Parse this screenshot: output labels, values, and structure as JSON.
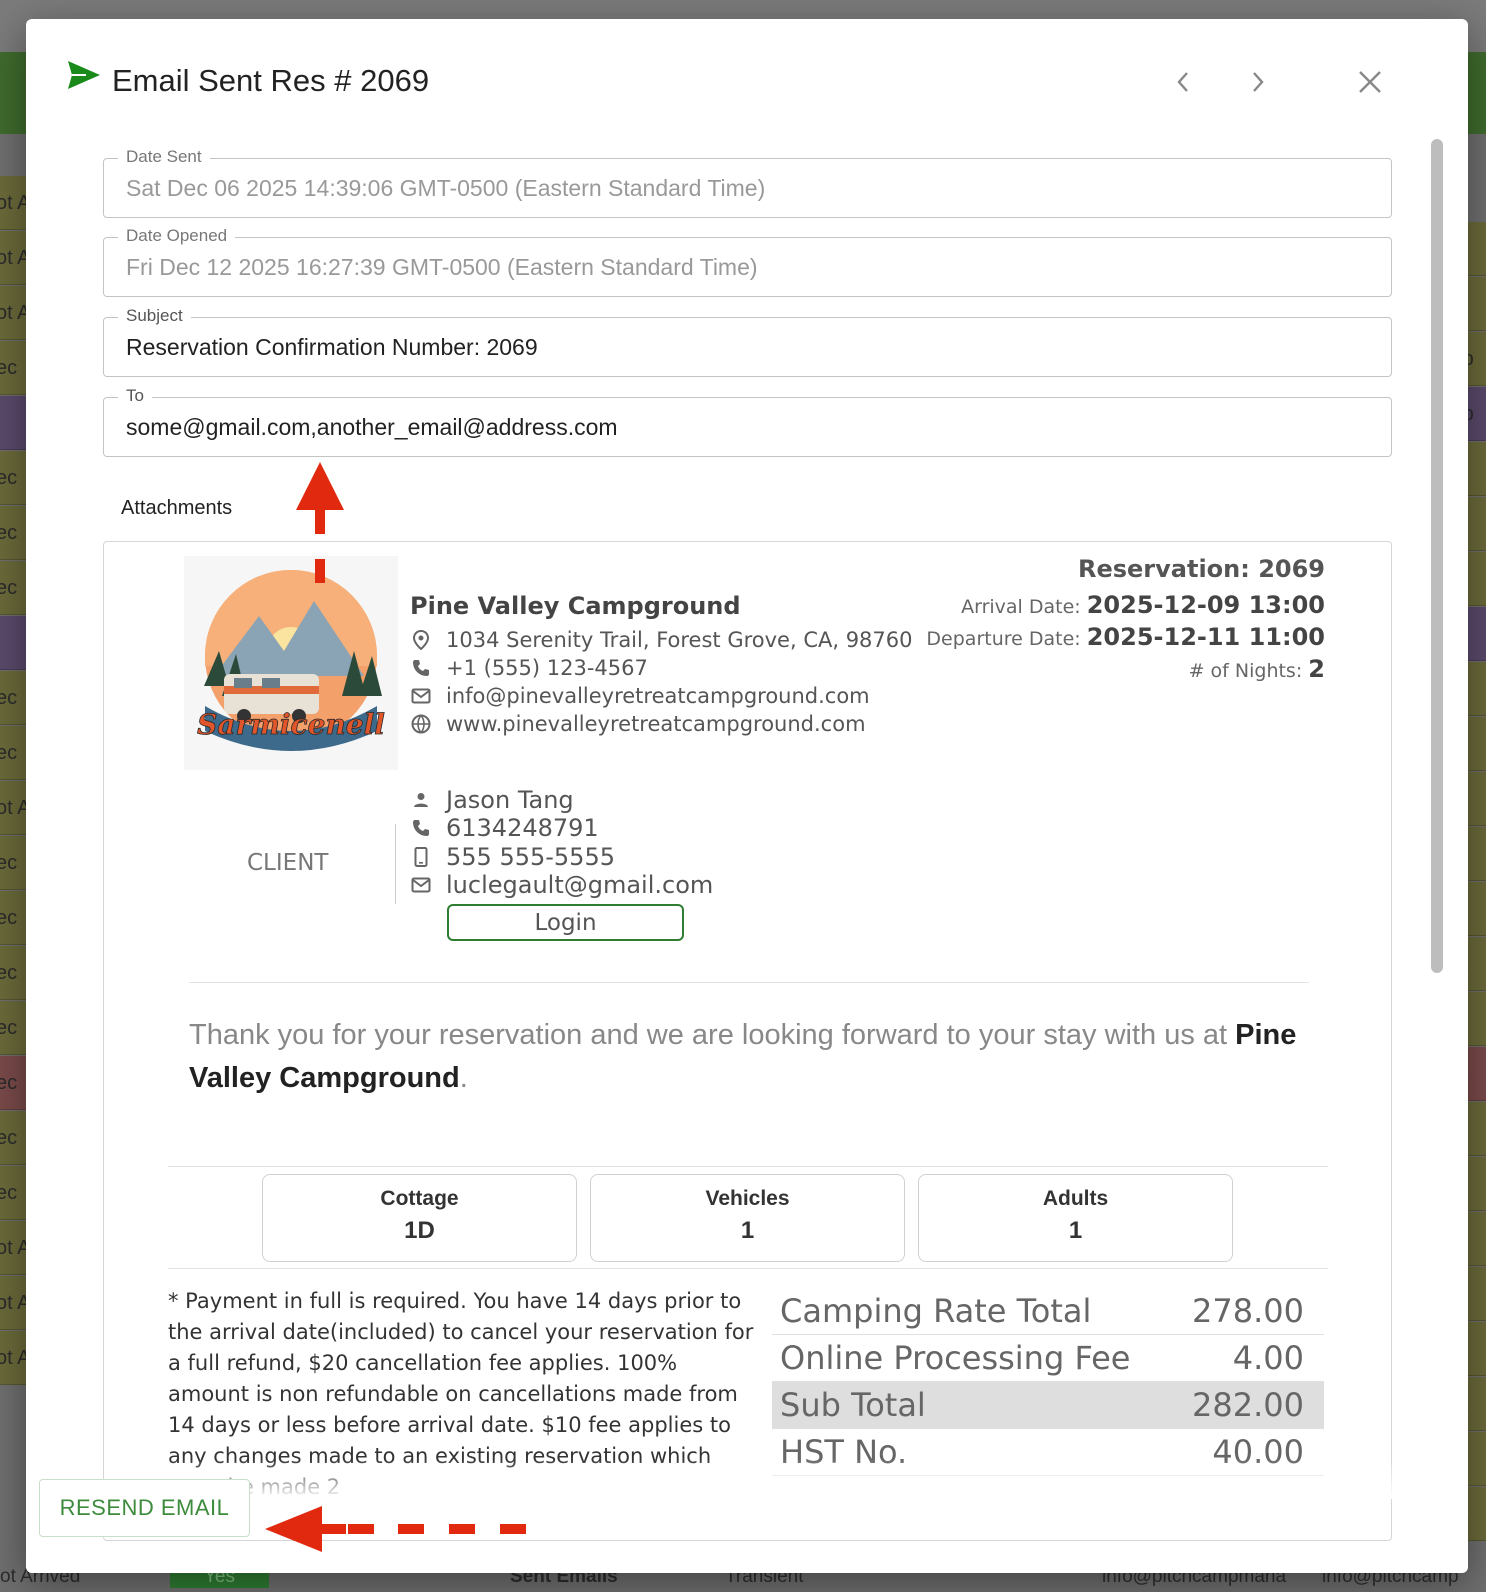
{
  "background": {
    "left_rows": [
      "ot A",
      "ot A",
      "ot A",
      "ec",
      "",
      "ec",
      "ec",
      "ec",
      "",
      "ec",
      "ec",
      "ot A",
      "ec",
      "ec",
      "ec",
      "ec",
      "ec",
      "ec",
      "ec",
      "ot A",
      "ot A",
      "ot A"
    ],
    "right_rows": [
      "cc",
      "",
      "mp",
      "mp",
      "",
      "",
      "",
      "",
      "",
      "",
      "na",
      "",
      "",
      "na",
      "na",
      "na",
      "na",
      "na",
      "",
      "na",
      "na",
      "na",
      "na",
      "na"
    ],
    "bottom_left": "ot Arrived",
    "bottom_yes": "Yes",
    "bottom_sent": "Sent Emails",
    "bottom_transient": "Transient",
    "bottom_email1": "info@pitchcampmana",
    "bottom_email2": "info@pitchcamp"
  },
  "dialog": {
    "title": "Email Sent Res # 2069",
    "fields": {
      "date_sent_label": "Date Sent",
      "date_sent_value": "Sat Dec 06 2025 14:39:06 GMT-0500 (Eastern Standard Time)",
      "date_opened_label": "Date Opened",
      "date_opened_value": "Fri Dec 12 2025 16:27:39 GMT-0500 (Eastern Standard Time)",
      "subject_label": "Subject",
      "subject_value": "Reservation Confirmation Number: 2069",
      "to_label": "To",
      "to_value": "some@gmail.com,another_email@address.com"
    },
    "attachments_label": "Attachments",
    "resend_label": "RESEND EMAIL"
  },
  "email": {
    "logo_text": "Sarmicenell",
    "company_name": "Pine Valley Campground",
    "address": "1034 Serenity Trail, Forest Grove, CA, 98760",
    "phone": "+1 (555) 123-4567",
    "email": "info@pinevalleyretreatcampground.com",
    "website": "www.pinevalleyretreatcampground.com",
    "reservation_title": "Reservation: 2069",
    "arrival_label": "Arrival Date:",
    "arrival_value": "2025-12-09 13:00",
    "departure_label": "Departure Date:",
    "departure_value": "2025-12-11 11:00",
    "nights_label": "# of Nights:",
    "nights_value": "2",
    "client_label": "CLIENT",
    "client_name": "Jason Tang",
    "client_phone": "6134248791",
    "client_mobile": "555 555-5555",
    "client_email": "luclegault@gmail.com",
    "login_label": "Login",
    "thanks_text": "Thank you for your reservation and we are looking forward to your stay with us at",
    "thanks_company": "Pine Valley Campground",
    "thanks_period": ".",
    "stats": [
      {
        "label": "Cottage",
        "value": "1D"
      },
      {
        "label": "Vehicles",
        "value": "1"
      },
      {
        "label": "Adults",
        "value": "1"
      }
    ],
    "policy": "* Payment in full is required. You have 14 days prior to the arrival date(included) to cancel your reservation for a full refund, $20 cancellation fee applies. 100% amount is non refundable on cancellations made from 14 days or less before arrival date. $10 fee applies to any changes made to an existing reservation which must be made 2",
    "totals": [
      {
        "label": "Camping Rate Total",
        "value": "278.00"
      },
      {
        "label": "Online Processing Fee",
        "value": "4.00"
      },
      {
        "label": "Sub Total",
        "value": "282.00"
      },
      {
        "label": "HST No.",
        "value": "40.00"
      }
    ]
  },
  "colors": {
    "accent_green": "#2e7d32",
    "annotation_red": "#e0290f",
    "send_icon_green": "#1a8a1a"
  },
  "icons": [
    "send-icon",
    "chevron-left-icon",
    "chevron-right-icon",
    "close-icon",
    "location-icon",
    "phone-icon",
    "mail-icon",
    "globe-icon",
    "person-icon",
    "mobile-icon"
  ]
}
